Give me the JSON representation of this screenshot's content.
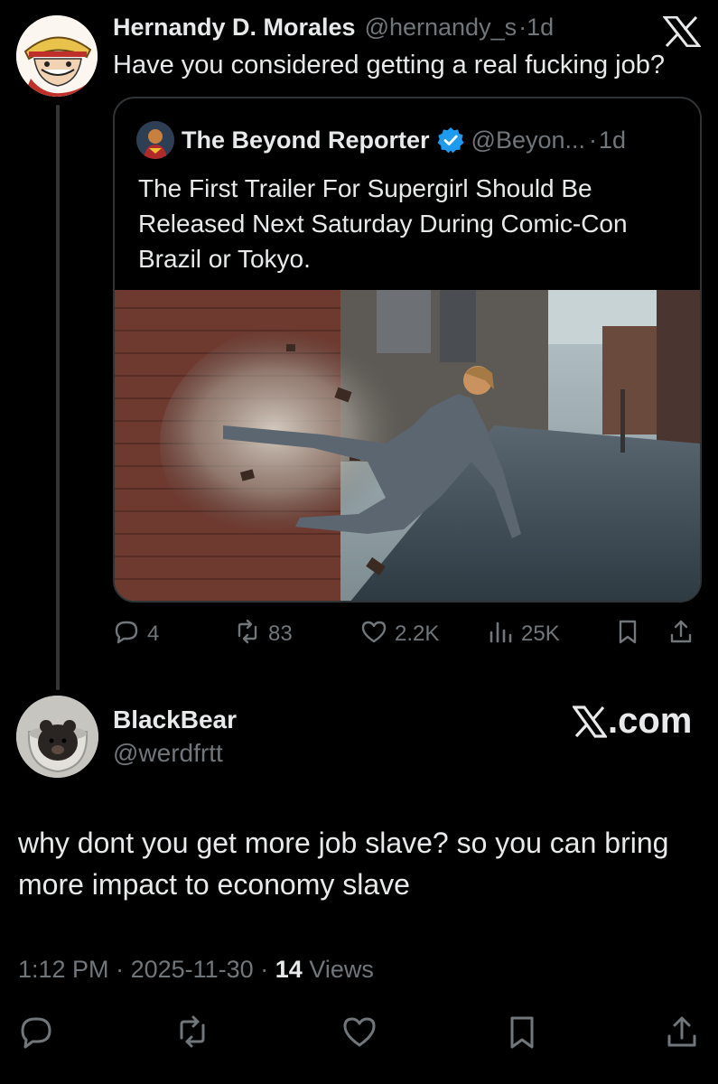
{
  "tweet": {
    "author": {
      "name": "Hernandy D. Morales",
      "handle": "@hernandy_s",
      "time": "1d"
    },
    "separator": "·",
    "text": "Have you considered getting a real fucking job?",
    "quote": {
      "name": "The Beyond Reporter",
      "verified": true,
      "handle": "@Beyon...",
      "time": "1d",
      "text": "The First Trailer For Supergirl Should Be Released Next Saturday During Comic-Con Brazil or Tokyo."
    },
    "stats": {
      "replies": "4",
      "reposts": "83",
      "likes": "2.2K",
      "views": "25K"
    }
  },
  "reply": {
    "name": "BlackBear",
    "handle": "@werdfrtt",
    "watermark": ".com",
    "text": "why dont you get more job slave? so you can bring more impact to economy slave",
    "time": "1:12 PM",
    "date": "2025-11-30",
    "views_count": "14",
    "views_label": "Views"
  },
  "colors": {
    "background": "#000000",
    "text": "#e7e9ea",
    "muted": "#71767b",
    "border": "#2f3336",
    "verified": "#1d9bf0"
  },
  "icons": [
    "x-logo-icon",
    "verified-badge-icon",
    "reply-icon",
    "repost-icon",
    "like-icon",
    "views-icon",
    "bookmark-icon",
    "share-icon"
  ]
}
